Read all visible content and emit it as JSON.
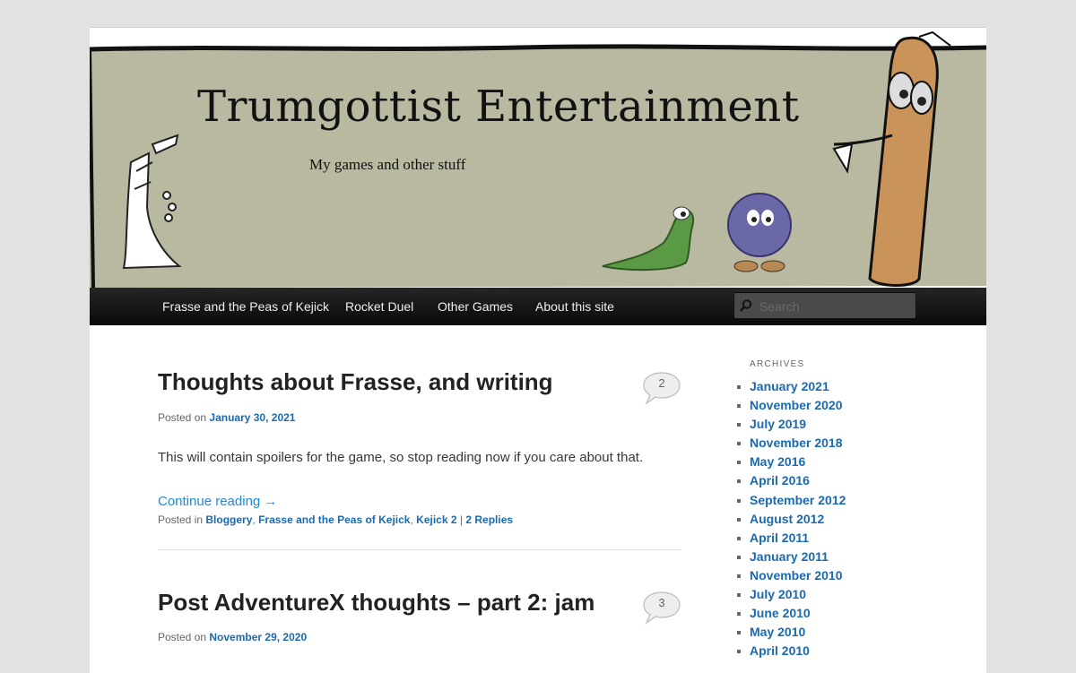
{
  "site": {
    "title": "Trumgottist Entertainment",
    "description": "My games and other stuff"
  },
  "nav": {
    "items": [
      {
        "label": "Frasse and the Peas of Kejick"
      },
      {
        "label": "Rocket Duel"
      },
      {
        "label": "Other Games"
      },
      {
        "label": "About this site"
      }
    ],
    "search_placeholder": "Search",
    "search_icon": "search-icon"
  },
  "posts": [
    {
      "title": "Thoughts about Frasse, and writing",
      "comment_count": "2",
      "posted_on_label": "Posted on",
      "date": "January 30, 2021",
      "excerpt": "This will contain spoilers for the game, so stop reading now if you care about that.",
      "continue_label": "Continue reading →",
      "posted_in_label": "Posted in",
      "categories": [
        "Bloggery",
        "Frasse and the Peas of Kejick",
        "Kejick 2"
      ],
      "separator": "|",
      "replies_label": "2 Replies"
    },
    {
      "title": "Post AdventureX thoughts – part 2: jam",
      "comment_count": "3",
      "posted_on_label": "Posted on",
      "date": "November 29, 2020"
    }
  ],
  "sidebar": {
    "archives_heading": "ARCHIVES",
    "archives": [
      "January 2021",
      "November 2020",
      "July 2019",
      "November 2018",
      "May 2016",
      "April 2016",
      "September 2012",
      "August 2012",
      "April 2011",
      "January 2011",
      "November 2010",
      "July 2010",
      "June 2010",
      "May 2010",
      "April 2010"
    ]
  },
  "colors": {
    "banner_bg": "#b8b9a0",
    "link": "#1b6ab0",
    "nav_bg": "#111111"
  }
}
